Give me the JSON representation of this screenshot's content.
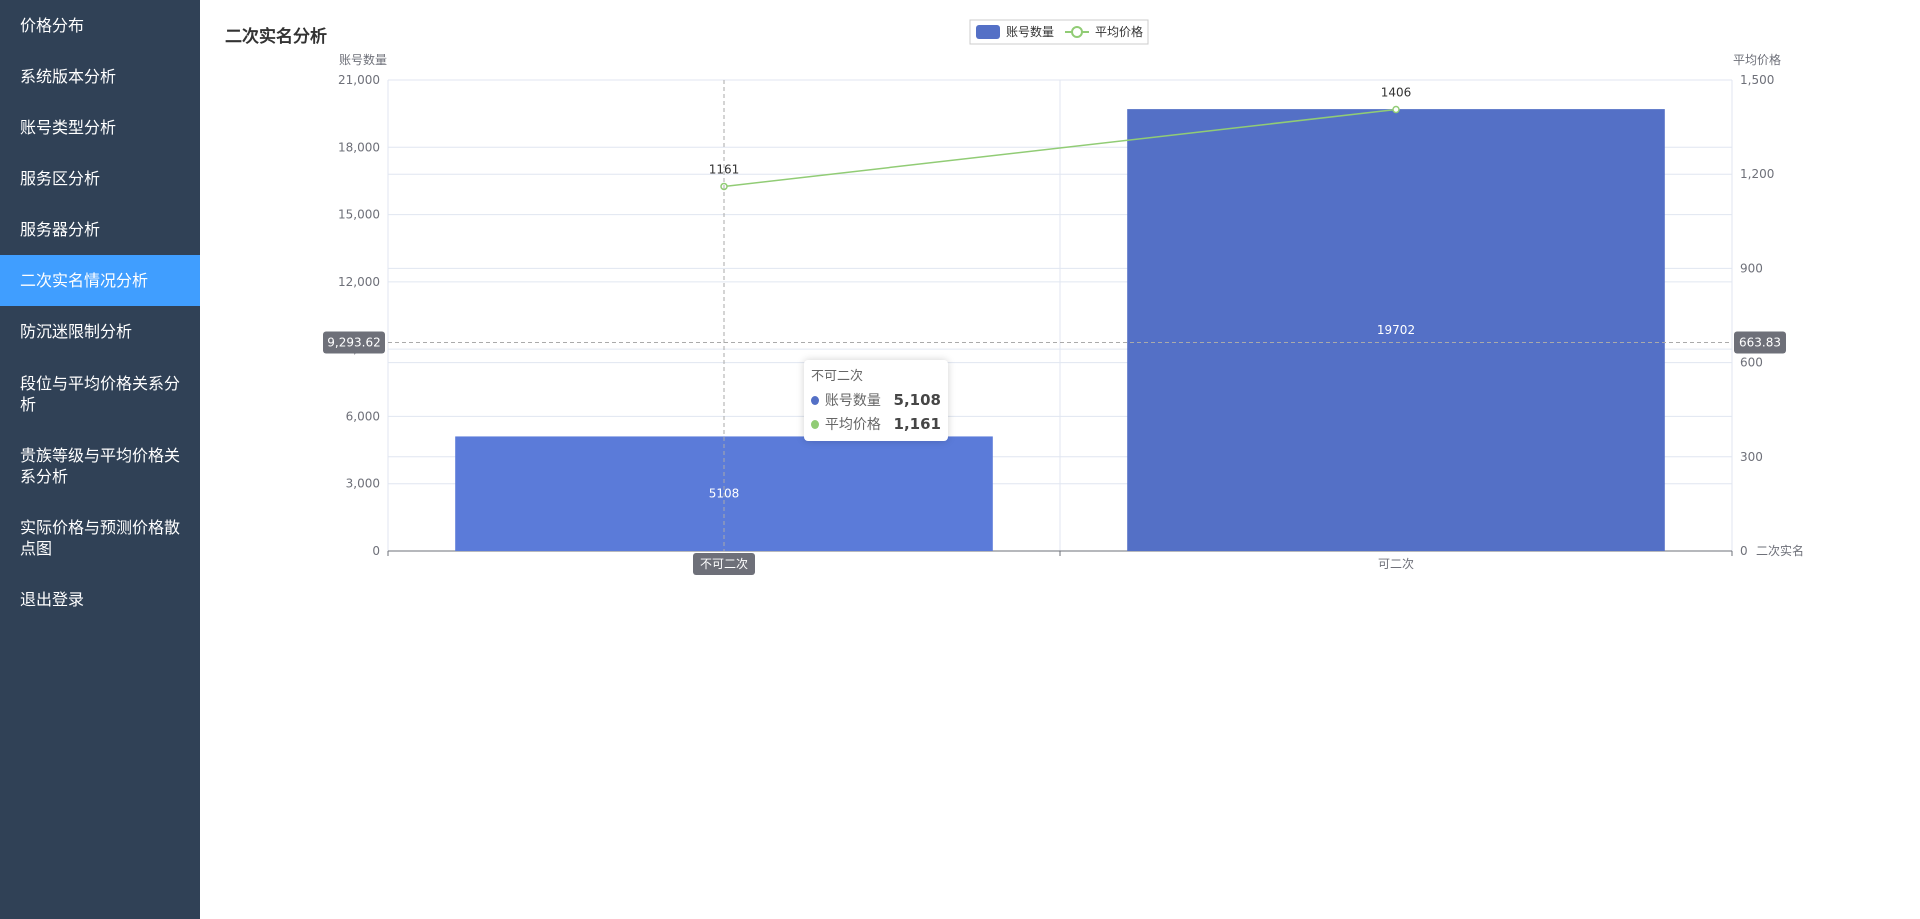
{
  "sidebar": {
    "items": [
      {
        "label": "价格分布",
        "active": false
      },
      {
        "label": "系统版本分析",
        "active": false
      },
      {
        "label": "账号类型分析",
        "active": false
      },
      {
        "label": "服务区分析",
        "active": false
      },
      {
        "label": "服务器分析",
        "active": false
      },
      {
        "label": "二次实名情况分析",
        "active": true
      },
      {
        "label": "防沉迷限制分析",
        "active": false
      },
      {
        "label": "段位与平均价格关系分析",
        "active": false
      },
      {
        "label": "贵族等级与平均价格关系分析",
        "active": false
      },
      {
        "label": "实际价格与预测价格散点图",
        "active": false
      },
      {
        "label": "退出登录",
        "active": false
      }
    ]
  },
  "page": {
    "title": "二次实名分析"
  },
  "chart_data": {
    "type": "bar",
    "categories": [
      "不可二次",
      "可二次"
    ],
    "xlabel": "二次实名",
    "legend": {
      "placement": "top-center",
      "items": [
        "账号数量",
        "平均价格"
      ]
    },
    "y_left": {
      "label": "账号数量",
      "range": [
        0,
        21000
      ],
      "ticks": [
        0,
        3000,
        6000,
        9000,
        12000,
        15000,
        18000,
        21000
      ]
    },
    "y_right": {
      "label": "平均价格",
      "range": [
        0,
        1500
      ],
      "ticks": [
        0,
        300,
        600,
        900,
        1200,
        1500
      ]
    },
    "series": [
      {
        "name": "账号数量",
        "type": "bar",
        "axis": "left",
        "color": "#5470c6",
        "values": [
          5108,
          19702
        ]
      },
      {
        "name": "平均价格",
        "type": "line",
        "axis": "right",
        "color": "#91cc75",
        "values": [
          1161,
          1406
        ]
      }
    ],
    "grid": true,
    "crosshair": {
      "category": "不可二次",
      "left_value": "9,293.62",
      "right_value": "663.83"
    },
    "tooltip": {
      "title": "不可二次",
      "rows": [
        {
          "name": "账号数量",
          "value": "5,108",
          "color": "#5470c6"
        },
        {
          "name": "平均价格",
          "value": "1,161",
          "color": "#91cc75"
        }
      ]
    }
  }
}
